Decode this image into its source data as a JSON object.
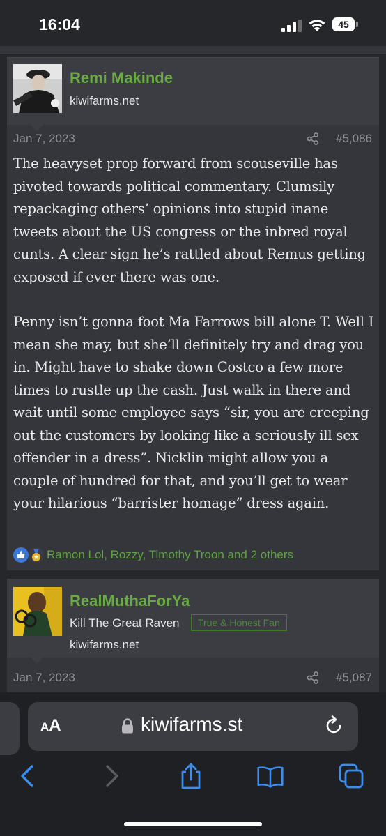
{
  "status_bar": {
    "time": "16:04",
    "battery": "45"
  },
  "posts": [
    {
      "author": "Remi Makinde",
      "subtitle": "kiwifarms.net",
      "date": "Jan 7, 2023",
      "post_number": "#5,086",
      "paragraphs": [
        "The heavyset prop forward from scouseville has pivoted towards political commentary. Clumsily repackaging others’ opinions into stupid inane tweets about the US congress or the inbred royal cunts. A clear sign he’s rattled about Remus getting exposed if ever there was one.",
        "Penny isn’t gonna foot Ma Farrows bill alone T. Well I mean she may, but she’ll definitely try and drag you in. Might have to shake down Costco a few more times to rustle up the cash. Just walk in there and wait until some employee says “sir, you are creeping out the customers by looking like a seriously ill sex offender in a dress”. Nicklin might allow you a couple of hundred for that, and you’ll get to wear your hilarious “barrister homage” dress again."
      ],
      "reactions": "Ramon Lol, Rozzy, Timothy Troon and 2 others"
    },
    {
      "author": "RealMuthaForYa",
      "user_title": "Kill The Great Raven",
      "badge": "True & Honest Fan",
      "subtitle": "kiwifarms.net",
      "date": "Jan 7, 2023",
      "post_number": "#5,087"
    }
  ],
  "browser": {
    "text_size_small": "A",
    "text_size_big": "A",
    "url": "kiwifarms.st"
  },
  "colors": {
    "username": "#6aaa45",
    "reaction_text": "#5ea33e",
    "ios_blue": "#3a8ef0"
  },
  "icons": [
    "signal-icon",
    "wifi-icon",
    "battery-icon",
    "share-icon",
    "like-icon",
    "medal-icon",
    "lock-icon",
    "reload-icon",
    "back-icon",
    "forward-icon",
    "share-sheet-icon",
    "bookmarks-icon",
    "tabs-icon"
  ]
}
